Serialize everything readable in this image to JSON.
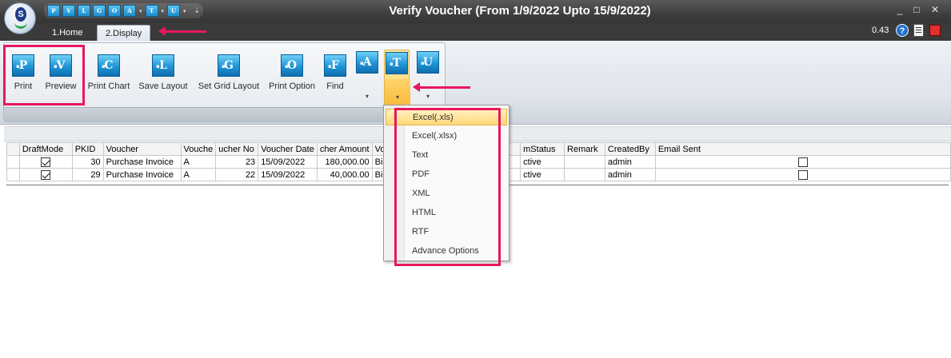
{
  "window": {
    "title": "Verify Voucher (From 1/9/2022 Upto 15/9/2022)",
    "controls": {
      "minimize": "_",
      "maximize": "□",
      "close": "✕"
    }
  },
  "quick_access": {
    "buttons": [
      {
        "icon": "print-icon",
        "letter": "P"
      },
      {
        "icon": "preview-icon",
        "letter": "V"
      },
      {
        "icon": "layout-icon",
        "letter": "L"
      },
      {
        "icon": "grid-layout-icon",
        "letter": "G"
      },
      {
        "icon": "option-icon",
        "letter": "O"
      },
      {
        "icon": "a-icon",
        "letter": "A"
      },
      {
        "icon": "export-icon",
        "letter": "T"
      },
      {
        "icon": "u-icon",
        "letter": "U"
      }
    ]
  },
  "tabs": [
    {
      "label": "1.Home",
      "active": false
    },
    {
      "label": "2.Display",
      "active": true
    }
  ],
  "status": {
    "zoom": "0.43"
  },
  "ribbon": {
    "buttons": [
      {
        "label": "Print",
        "letter": "P"
      },
      {
        "label": "Preview",
        "letter": "V"
      },
      {
        "label": "Print Chart",
        "letter": "C"
      },
      {
        "label": "Save Layout",
        "letter": "L"
      },
      {
        "label": "Set Grid Layout",
        "letter": "G"
      },
      {
        "label": "Print Option",
        "letter": "O"
      },
      {
        "label": "Find",
        "letter": "F"
      }
    ],
    "split_buttons": [
      {
        "letter": "A",
        "caret": "▾"
      },
      {
        "letter": "T",
        "caret": "▾",
        "open": true
      },
      {
        "letter": "U",
        "caret": "▾"
      }
    ]
  },
  "grid": {
    "columns": [
      "DraftMode",
      "PKID",
      "Voucher",
      "Vouche",
      "ucher No",
      "Voucher Date",
      "cher Amount",
      "Vou",
      "",
      "mStatus",
      "Remark",
      "CreatedBy",
      "Email Sent"
    ],
    "rows": [
      {
        "draft": true,
        "pkid": "30",
        "voucher": "Purchase Invoice",
        "series": "A",
        "no": "23",
        "date": "15/09/2022",
        "amount": "180,000.00",
        "vou": "Bill",
        "status": "ctive",
        "remark": "",
        "created_by": "admin",
        "email_sent": false
      },
      {
        "draft": true,
        "pkid": "29",
        "voucher": "Purchase Invoice",
        "series": "A",
        "no": "22",
        "date": "15/09/2022",
        "amount": "40,000.00",
        "vou": "Bill",
        "status": "ctive",
        "remark": "",
        "created_by": "admin",
        "email_sent": false
      }
    ]
  },
  "export_menu": {
    "items": [
      "Excel(.xls)",
      "Excel(.xlsx)",
      "Text",
      "PDF",
      "XML",
      "HTML",
      "RTF",
      "Advance Options"
    ],
    "highlighted": "Excel(.xls)"
  },
  "colors": {
    "annotation": "#e8175d",
    "titlebar": "#3e3e3e",
    "ribbon_icon": "#1f95d6",
    "menu_highlight": "#ffd97a"
  }
}
